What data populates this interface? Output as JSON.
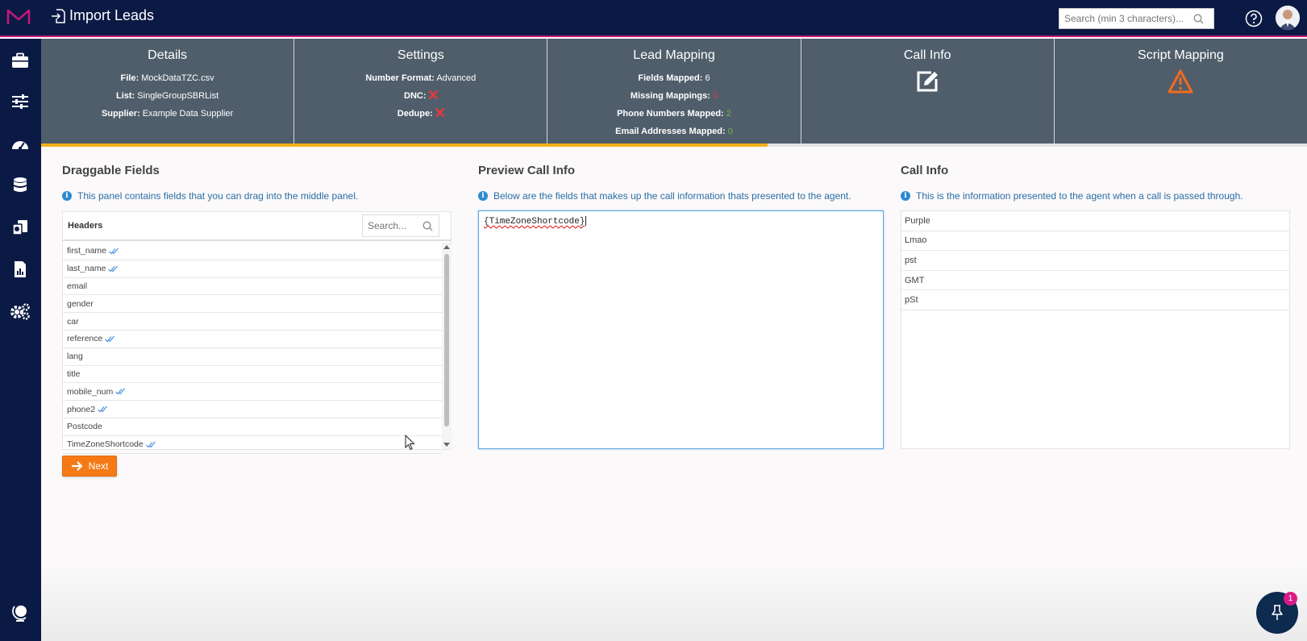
{
  "app": {
    "title": "Import Leads"
  },
  "search": {
    "placeholder": "Search (min 3 characters)..."
  },
  "sidebar": {
    "icons": [
      "briefcase-icon",
      "sliders-icon",
      "dashboard-gauge-icon",
      "database-icon",
      "file-copy-icon",
      "report-chart-icon",
      "cogs-icon",
      "globe-icon"
    ]
  },
  "steps": {
    "details": {
      "title": "Details",
      "file_label": "File:",
      "file_value": "MockDataTZC.csv",
      "list_label": "List:",
      "list_value": "SingleGroupSBRList",
      "supplier_label": "Supplier:",
      "supplier_value": "Example Data Supplier"
    },
    "settings": {
      "title": "Settings",
      "number_format_label": "Number Format:",
      "number_format_value": "Advanced",
      "dnc_label": "DNC:",
      "dedupe_label": "Dedupe:"
    },
    "lead_mapping": {
      "title": "Lead Mapping",
      "fields_mapped_label": "Fields Mapped:",
      "fields_mapped_value": "6",
      "missing_label": "Missing Mappings:",
      "missing_value": "0",
      "phone_label": "Phone Numbers Mapped:",
      "phone_value": "2",
      "email_label": "Email Addresses Mapped:",
      "email_value": "0"
    },
    "call_info": {
      "title": "Call Info"
    },
    "script_mapping": {
      "title": "Script Mapping"
    }
  },
  "progress": {
    "fraction": 0.574
  },
  "colors": {
    "navy": "#0a1a44",
    "steps_bg": "#505e6b",
    "accent_pink": "#c2187a",
    "progress": "#f4b21a",
    "next_button": "#f57a16",
    "info_blue": "#2c6da5",
    "error_red": "#e5383b",
    "ok_green": "#6fbf4a",
    "warning_orange": "#f26b1d"
  },
  "draggable": {
    "title": "Draggable Fields",
    "info": "This panel contains fields that you can drag into the middle panel.",
    "header_label": "Headers",
    "search_placeholder": "Search...",
    "fields": [
      {
        "name": "first_name",
        "mapped": true
      },
      {
        "name": "last_name",
        "mapped": true
      },
      {
        "name": "email",
        "mapped": false
      },
      {
        "name": "gender",
        "mapped": false
      },
      {
        "name": "car",
        "mapped": false
      },
      {
        "name": "reference",
        "mapped": true
      },
      {
        "name": "lang",
        "mapped": false
      },
      {
        "name": "title",
        "mapped": false
      },
      {
        "name": "mobile_num",
        "mapped": true
      },
      {
        "name": "phone2",
        "mapped": true
      },
      {
        "name": "Postcode",
        "mapped": false
      },
      {
        "name": "TimeZoneShortcode",
        "mapped": true
      }
    ]
  },
  "next_button": {
    "label": "Next"
  },
  "preview": {
    "title": "Preview Call Info",
    "info": "Below are the fields that makes up the call information thats presented to the agent.",
    "content": "{TimeZoneShortcode}"
  },
  "callinfo": {
    "title": "Call Info",
    "info": "This is the information presented to the agent when a call is passed through.",
    "rows": [
      "Purple",
      "Lmao",
      "pst",
      "GMT",
      "pSt"
    ]
  },
  "notifications": {
    "count": "1"
  }
}
